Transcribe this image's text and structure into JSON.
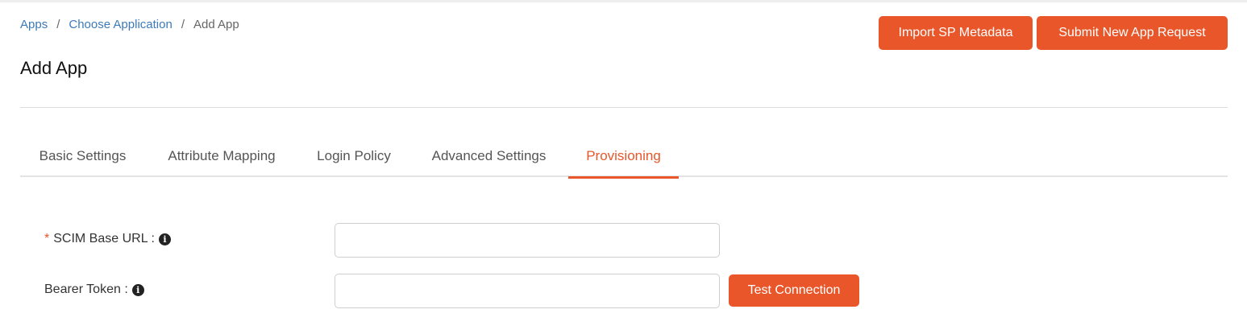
{
  "breadcrumb": {
    "items": [
      "Apps",
      "Choose Application",
      "Add App"
    ],
    "separator": "/"
  },
  "page": {
    "title": "Add App"
  },
  "actions": {
    "import_label": "Import SP Metadata",
    "submit_label": "Submit New App Request"
  },
  "tabs": [
    {
      "label": "Basic Settings",
      "active": false
    },
    {
      "label": "Attribute Mapping",
      "active": false
    },
    {
      "label": "Login Policy",
      "active": false
    },
    {
      "label": "Advanced Settings",
      "active": false
    },
    {
      "label": "Provisioning",
      "active": true
    }
  ],
  "form": {
    "scim_base_url": {
      "label": "SCIM Base URL :",
      "required_mark": "*",
      "value": "",
      "info_icon": "info-circle-icon"
    },
    "bearer_token": {
      "label": "Bearer Token :",
      "value": "",
      "info_icon": "info-circle-icon"
    },
    "test_connection_label": "Test Connection"
  },
  "colors": {
    "accent": "#e8562a",
    "link": "#3d7ab8"
  }
}
